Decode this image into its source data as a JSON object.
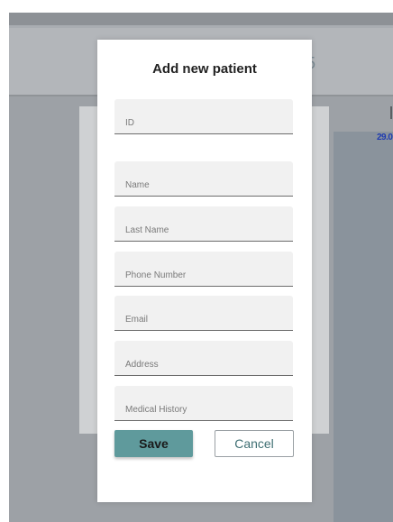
{
  "background": {
    "peek_char": "5",
    "peek_date": "29.0"
  },
  "modal": {
    "title": "Add new patient",
    "fields": [
      {
        "name": "id",
        "placeholder": "ID"
      },
      {
        "name": "name",
        "placeholder": "Name"
      },
      {
        "name": "last_name",
        "placeholder": "Last Name"
      },
      {
        "name": "phone",
        "placeholder": "Phone Number"
      },
      {
        "name": "email",
        "placeholder": "Email"
      },
      {
        "name": "address",
        "placeholder": "Address"
      },
      {
        "name": "medical_history",
        "placeholder": "Medical History"
      }
    ],
    "save_label": "Save",
    "cancel_label": "Cancel"
  },
  "colors": {
    "accent": "#5f9a9c",
    "overlay": "#9da1a6"
  }
}
